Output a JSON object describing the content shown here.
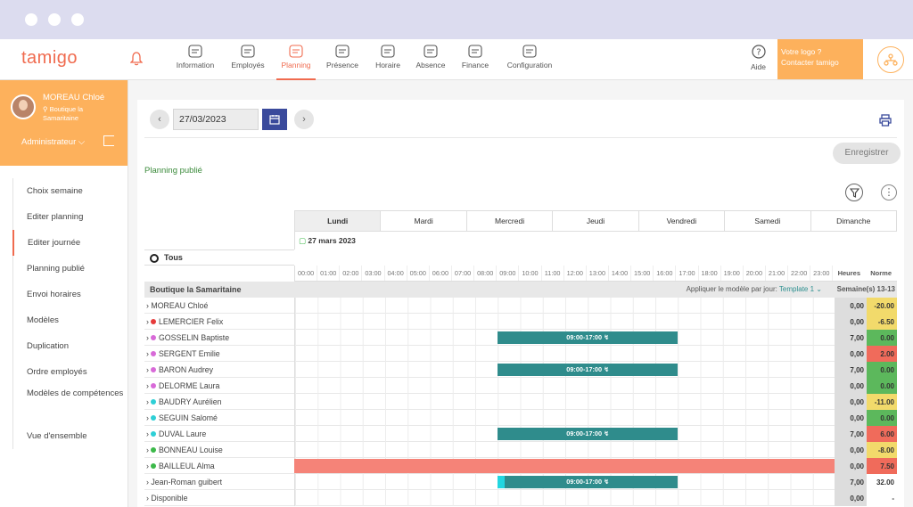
{
  "brand": {
    "logo": "tamigo",
    "accent": "#f06b4f",
    "orange": "#fdb15c"
  },
  "nav": {
    "items": [
      {
        "label": "Information",
        "icon": "info-icon"
      },
      {
        "label": "Employés",
        "icon": "employees-icon"
      },
      {
        "label": "Planning",
        "icon": "planning-icon",
        "active": true
      },
      {
        "label": "Présence",
        "icon": "presence-icon"
      },
      {
        "label": "Horaire",
        "icon": "schedule-icon"
      },
      {
        "label": "Absence",
        "icon": "absence-icon"
      },
      {
        "label": "Finance",
        "icon": "finance-icon"
      },
      {
        "label": "Configuration",
        "icon": "gear-icon"
      }
    ],
    "help": "Aide",
    "logo_line1": "Votre logo ?",
    "logo_line2": "Contacter tamigo"
  },
  "user": {
    "name": "MOREAU Chloé",
    "shop": "Boutique la Samaritaine",
    "role": "Administrateur"
  },
  "sidebar": {
    "items": [
      {
        "label": "Choix semaine"
      },
      {
        "label": "Editer planning"
      },
      {
        "label": "Editer journée",
        "active": true
      },
      {
        "label": "Planning publié"
      },
      {
        "label": "Envoi horaires"
      },
      {
        "label": "Modèles"
      },
      {
        "label": "Duplication"
      },
      {
        "label": "Ordre employés"
      },
      {
        "label": "Modèles de compétences"
      },
      {
        "label": "Vue d'ensemble"
      }
    ]
  },
  "toolbar": {
    "date": "27/03/2023",
    "save_label": "Enregistrer",
    "status": "Planning publié"
  },
  "schedule": {
    "days": [
      "Lundi",
      "Mardi",
      "Mercredi",
      "Jeudi",
      "Vendredi",
      "Samedi",
      "Dimanche"
    ],
    "active_day": "Lundi",
    "date_label": "27 mars 2023",
    "all_label": "Tous",
    "hours": [
      "00:00",
      "01:00",
      "02:00",
      "03:00",
      "04:00",
      "05:00",
      "06:00",
      "07:00",
      "08:00",
      "09:00",
      "10:00",
      "11:00",
      "12:00",
      "13:00",
      "14:00",
      "15:00",
      "16:00",
      "17:00",
      "18:00",
      "19:00",
      "20:00",
      "21:00",
      "22:00",
      "23:00"
    ],
    "col_hours": "Heures",
    "col_norm": "Norme",
    "store": "Boutique la Samaritaine",
    "template_prefix": "Appliquer le modèle par jour:",
    "template_name": "Template 1",
    "weeks": "Semaine(s) 13-13",
    "rows": [
      {
        "name": "MOREAU Chloé",
        "dot": null,
        "shift": null,
        "hours": "0,00",
        "norm": "-20.00",
        "norm_color": "#f2da6b"
      },
      {
        "name": "LEMERCIER Felix",
        "dot": "#e63b3b",
        "shift": null,
        "hours": "0,00",
        "norm": "-6.50",
        "norm_color": "#f2da6b"
      },
      {
        "name": "GOSSELIN Baptiste",
        "dot": "#d86ad8",
        "shift": "09:00-17:00 ↯",
        "hours": "7,00",
        "norm": "0.00",
        "norm_color": "#5cb85c"
      },
      {
        "name": "SERGENT Emilie",
        "dot": "#d86ad8",
        "shift": null,
        "hours": "0,00",
        "norm": "2.00",
        "norm_color": "#f06b5b"
      },
      {
        "name": "BARON Audrey",
        "dot": "#d86ad8",
        "shift": "09:00-17:00 ↯",
        "hours": "7,00",
        "norm": "0.00",
        "norm_color": "#5cb85c"
      },
      {
        "name": "DELORME Laura",
        "dot": "#d86ad8",
        "shift": null,
        "hours": "0,00",
        "norm": "0.00",
        "norm_color": "#5cb85c"
      },
      {
        "name": "BAUDRY Aurélien",
        "dot": "#2ecfd6",
        "shift": null,
        "hours": "0,00",
        "norm": "-11.00",
        "norm_color": "#f2da6b"
      },
      {
        "name": "SEGUIN Salomé",
        "dot": "#2ecfd6",
        "shift": null,
        "hours": "0,00",
        "norm": "0.00",
        "norm_color": "#5cb85c"
      },
      {
        "name": "DUVAL Laure",
        "dot": "#2ecfd6",
        "shift": "09:00-17:00 ↯",
        "hours": "7,00",
        "norm": "6.00",
        "norm_color": "#f06b5b"
      },
      {
        "name": "BONNEAU Louise",
        "dot": "#3cb94a",
        "shift": null,
        "hours": "0,00",
        "norm": "-8.00",
        "norm_color": "#f2da6b"
      },
      {
        "name": "BAILLEUL Alma",
        "dot": "#3cb94a",
        "shift": null,
        "absent": true,
        "hours": "0,00",
        "norm": "7.50",
        "norm_color": "#f06b5b"
      },
      {
        "name": "Jean-Roman guibert",
        "dot": null,
        "shift": "09:00-17:00 ↯",
        "cap": true,
        "hours": "7,00",
        "norm": "32.00",
        "norm_color": "#ffffff"
      },
      {
        "name": "Disponible",
        "dot": null,
        "shift": null,
        "hours": "0,00",
        "norm": "-",
        "norm_color": "#ffffff"
      }
    ]
  }
}
